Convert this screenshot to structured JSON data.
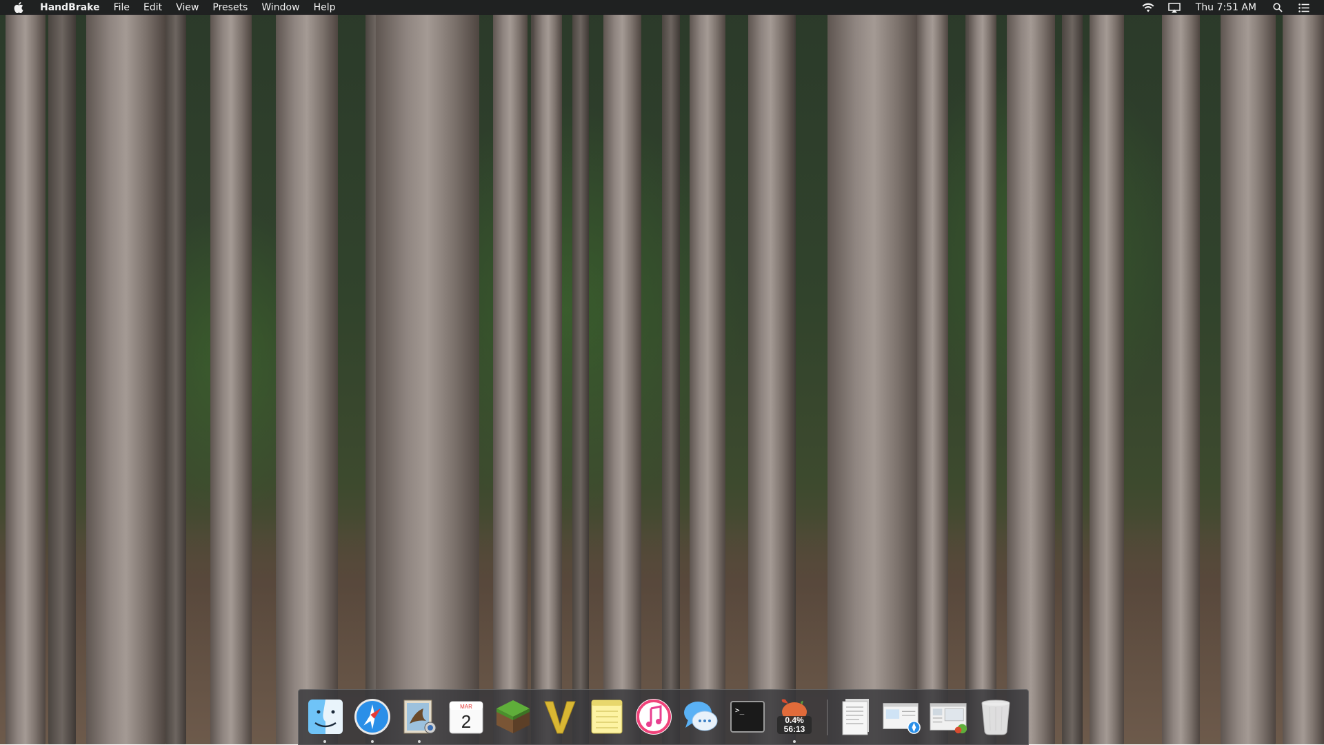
{
  "menubar": {
    "app_name": "HandBrake",
    "items": [
      "File",
      "Edit",
      "View",
      "Presets",
      "Window",
      "Help"
    ],
    "clock": "Thu 7:51 AM",
    "status_icons": [
      "wifi-icon",
      "airplay-icon",
      "spotlight-search-icon",
      "notification-center-icon"
    ]
  },
  "dock": {
    "apps": [
      {
        "name": "Finder",
        "icon": "finder-icon",
        "running": true
      },
      {
        "name": "Safari",
        "icon": "safari-icon",
        "running": true
      },
      {
        "name": "Mail",
        "icon": "mail-icon",
        "running": true
      },
      {
        "name": "Calendar",
        "icon": "calendar-icon",
        "running": false,
        "month": "MAR",
        "day": "2"
      },
      {
        "name": "Minecraft",
        "icon": "minecraft-icon",
        "running": false
      },
      {
        "name": "Vectorworks",
        "icon": "v-app-icon",
        "running": false
      },
      {
        "name": "Notes",
        "icon": "notes-icon",
        "running": false
      },
      {
        "name": "iTunes",
        "icon": "itunes-icon",
        "running": false
      },
      {
        "name": "Messages",
        "icon": "messages-icon",
        "running": false
      },
      {
        "name": "Terminal",
        "icon": "terminal-icon",
        "running": false,
        "prompt": ">_"
      },
      {
        "name": "HandBrake",
        "icon": "handbrake-icon",
        "running": true,
        "progress": "0.4%",
        "time": "56:13"
      }
    ],
    "documents": [
      {
        "name": "Document",
        "icon": "document-stack-icon"
      },
      {
        "name": "Downloads",
        "icon": "downloads-stack-icon"
      },
      {
        "name": "Screenshots",
        "icon": "screenshots-stack-icon"
      },
      {
        "name": "Trash",
        "icon": "trash-icon"
      }
    ]
  }
}
